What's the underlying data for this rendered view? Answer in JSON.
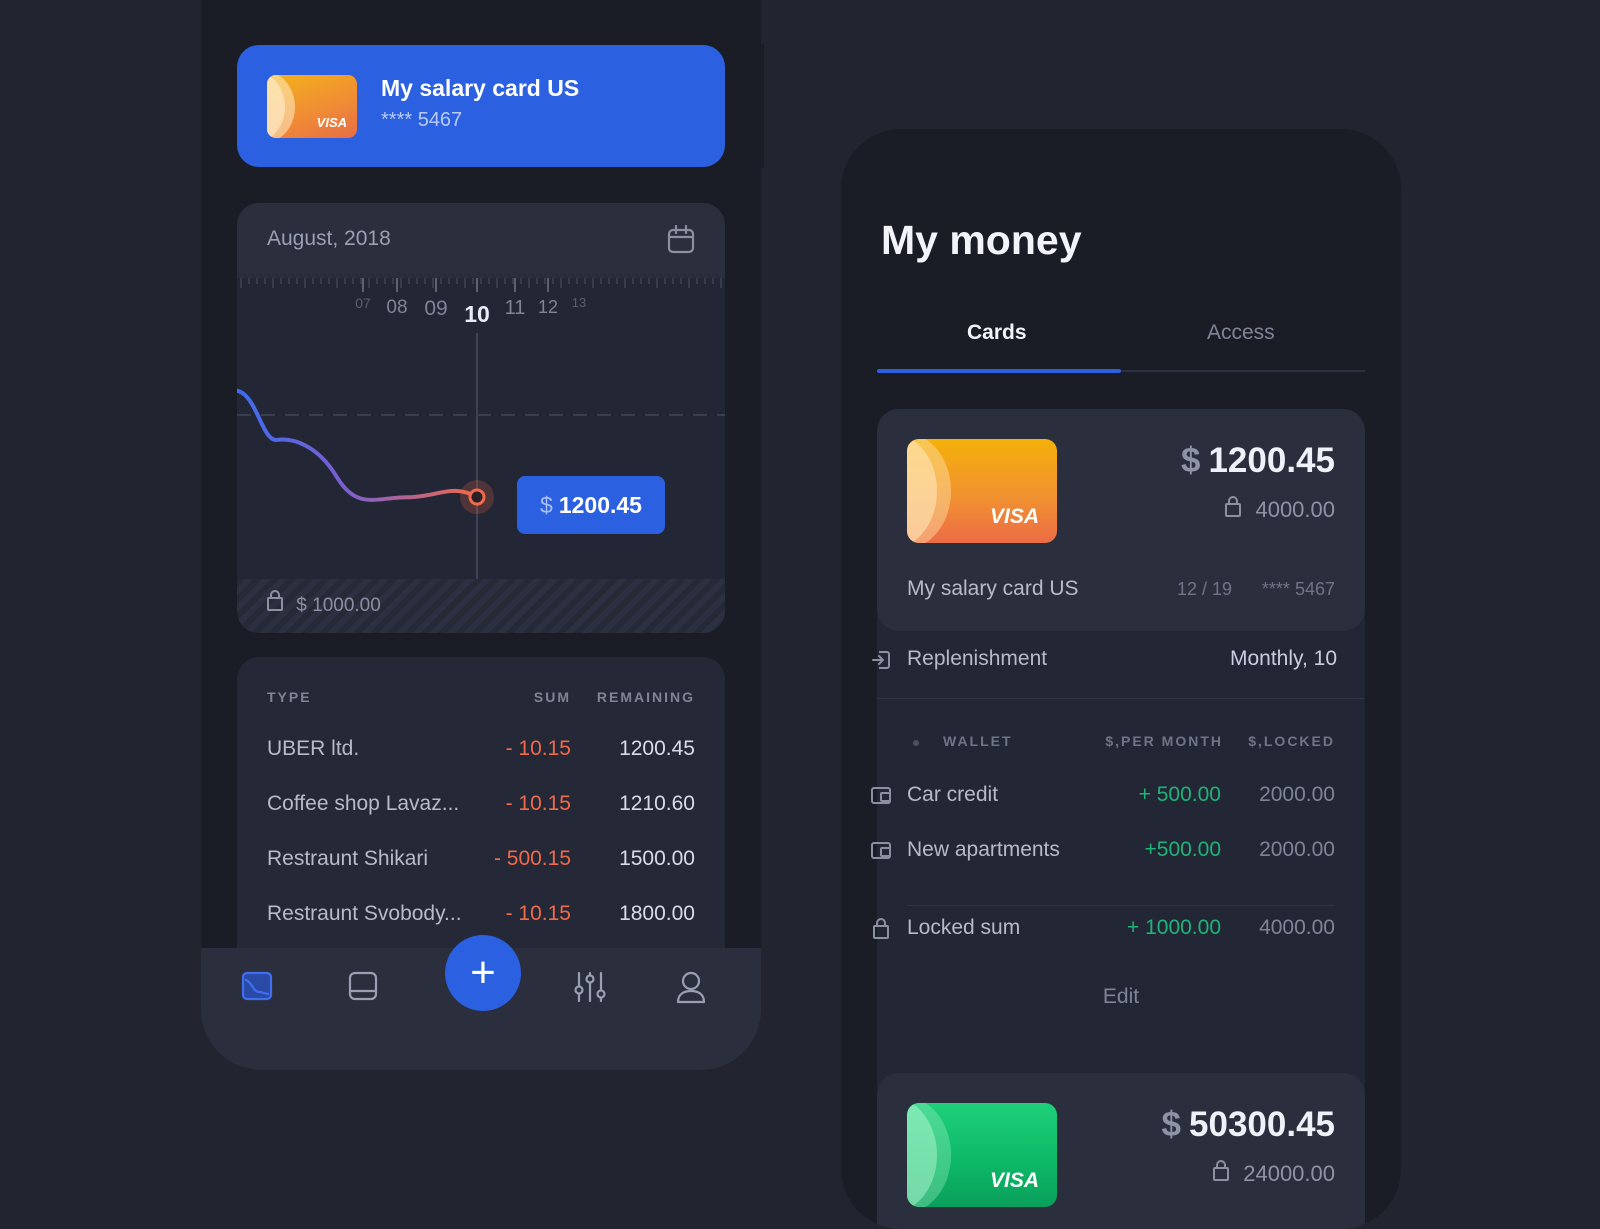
{
  "colors": {
    "accent": "#2b60e0",
    "negative": "#f06a4b",
    "positive": "#1eb478",
    "background": "#22252f"
  },
  "left": {
    "card_banner": {
      "title": "My salary card US",
      "number": "**** 5467",
      "brand": "VISA"
    },
    "graph": {
      "month": "August, 2018",
      "days": [
        "07",
        "08",
        "09",
        "10",
        "11",
        "12",
        "13"
      ],
      "selected_day": "10",
      "value_currency": "$",
      "value": "1200.45",
      "locked": "$ 1000.00"
    },
    "chart_data": {
      "type": "line",
      "x": [
        "07",
        "08",
        "09",
        "10"
      ],
      "series": [
        {
          "values": [
            1800,
            1500,
            1210.6,
            1200.45
          ]
        }
      ],
      "selected_value": 1200.45,
      "locked_level": 1000
    },
    "transactions": {
      "headers": {
        "type": "TYPE",
        "sum": "SUM",
        "remaining": "REMAINING"
      },
      "rows": [
        {
          "type": "UBER ltd.",
          "sum": "- 10.15",
          "remaining": "1200.45"
        },
        {
          "type": "Coffee shop Lavaz...",
          "sum": "- 10.15",
          "remaining": "1210.60"
        },
        {
          "type": "Restraunt Shikari",
          "sum": "- 500.15",
          "remaining": "1500.00"
        },
        {
          "type": "Restraunt Svobody...",
          "sum": "- 10.15",
          "remaining": "1800.00"
        }
      ]
    },
    "nav": {
      "items": [
        "chart-icon",
        "card-icon",
        "plus-icon",
        "sliders-icon",
        "user-icon"
      ],
      "plus_label": "+"
    }
  },
  "right": {
    "title": "My money",
    "tabs": [
      {
        "label": "Cards",
        "active": true
      },
      {
        "label": "Access",
        "active": false
      }
    ],
    "card1": {
      "brand": "VISA",
      "currency": "$",
      "balance": "1200.45",
      "locked": "4000.00",
      "name": "My salary card US",
      "expiry": "12 / 19",
      "number": "**** 5467"
    },
    "replenishment": {
      "label": "Replenishment",
      "value": "Monthly, 10"
    },
    "wallet": {
      "headers": {
        "wallet": "WALLET",
        "per_month": "$,PER MONTH",
        "locked": "$,LOCKED"
      },
      "rows": [
        {
          "name": "Car credit",
          "per_month": "+ 500.00",
          "locked": "2000.00"
        },
        {
          "name": "New apartments",
          "per_month": "+500.00",
          "locked": "2000.00"
        }
      ],
      "locked_sum": {
        "name": "Locked sum",
        "per_month": "+ 1000.00",
        "locked": "4000.00"
      },
      "edit_label": "Edit"
    },
    "card2": {
      "brand": "VISA",
      "currency": "$",
      "balance": "50300.45",
      "locked": "24000.00"
    }
  }
}
